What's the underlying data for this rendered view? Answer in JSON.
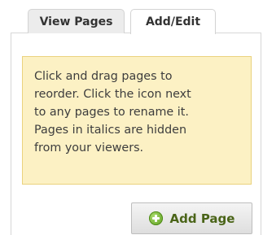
{
  "tabs": {
    "view_pages": "View Pages",
    "add_edit": "Add/Edit"
  },
  "info": {
    "line1": "Click and drag pages to",
    "line2": "reorder. Click the icon next",
    "line3": "to any pages to rename it.",
    "line4": "Pages in italics are hidden",
    "line5": "from your viewers."
  },
  "actions": {
    "add_page": "Add Page",
    "add_page_icon": "plus-circle-icon"
  },
  "colors": {
    "info_background": "#fcf1c4",
    "info_border": "#ead27e",
    "button_text": "#4a6418",
    "icon_green": "#6aad27"
  }
}
